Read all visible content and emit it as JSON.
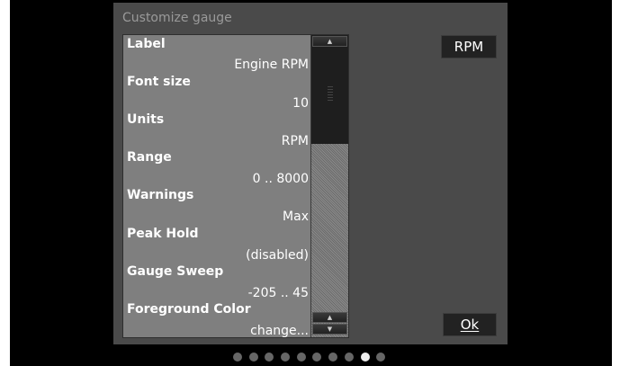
{
  "dialog": {
    "title": "Customize gauge"
  },
  "properties": [
    {
      "name": "Label",
      "value": "Engine RPM"
    },
    {
      "name": "Font size",
      "value": "10"
    },
    {
      "name": "Units",
      "value": "RPM"
    },
    {
      "name": "Range",
      "value": "0 .. 8000"
    },
    {
      "name": "Warnings",
      "value": "Max"
    },
    {
      "name": "Peak Hold",
      "value": "(disabled)"
    },
    {
      "name": "Gauge Sweep",
      "value": "-205 .. 45"
    },
    {
      "name": "Foreground Color",
      "value": "change..."
    }
  ],
  "buttons": {
    "rpm": "RPM",
    "ok": "Ok"
  },
  "scroll": {
    "up_glyph": "▲",
    "down_glyph": "▼",
    "thumb_fraction": 0.36
  },
  "pager": {
    "page_count": 10,
    "active_page": 9
  },
  "colors": {
    "screen_bg": "#000000",
    "dialog_bg": "#4a4a4a",
    "list_bg": "#7f7f7f",
    "button_bg": "#222222",
    "dot_inactive": "#666666",
    "dot_active": "#eeeeee"
  }
}
